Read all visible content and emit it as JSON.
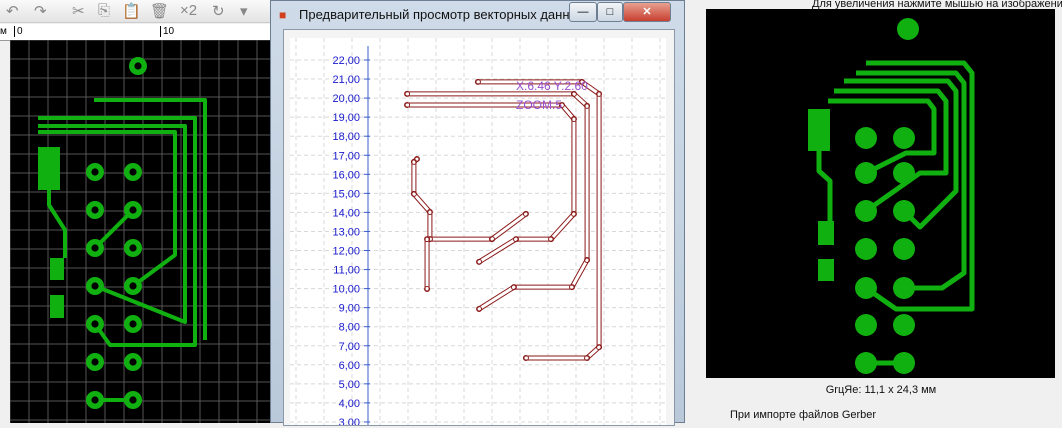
{
  "toolbar": {
    "buttons": [
      {
        "icon": "undo-icon",
        "label": "↶"
      },
      {
        "icon": "redo-icon",
        "label": "↷"
      },
      {
        "icon": "cut-icon",
        "label": "✂"
      },
      {
        "icon": "copy-icon",
        "label": "⎘"
      },
      {
        "icon": "paste-icon",
        "label": "📋"
      },
      {
        "icon": "delete-icon",
        "label": "🗑"
      },
      {
        "icon": "multiply-icon",
        "label": "×2"
      },
      {
        "icon": "rotate-icon",
        "label": "↻"
      },
      {
        "icon": "dropdown-icon",
        "label": "▾"
      }
    ]
  },
  "ruler": {
    "unit": "м",
    "ticks": [
      "0",
      "10"
    ]
  },
  "dialog": {
    "title": "Предварительный просмотр векторных данных",
    "minimize": "—",
    "maximize": "□",
    "close": "✕",
    "coords": "X:6.46 Y:2.60",
    "zoom": "ZOOM:5"
  },
  "chart_data": {
    "type": "line",
    "yticks": [
      "22,00",
      "21,00",
      "20,00",
      "19,00",
      "18,00",
      "17,00",
      "16,00",
      "15,00",
      "14,00",
      "13,00",
      "12,00",
      "11,00",
      "10,00",
      "9,00",
      "8,00",
      "7,00",
      "6,00",
      "5,00",
      "4,00",
      "3,00"
    ],
    "ylim": [
      3,
      22
    ],
    "grid": true,
    "colors": {
      "trace": "#8b1a1a",
      "axis": "#3a5fcd",
      "label": "#1a1acd",
      "annotation": "#9a4fd0"
    },
    "traces": [
      [
        [
          5.77,
          20.85
        ],
        [
          11.23,
          20.85
        ],
        [
          12.13,
          20.22
        ],
        [
          12.13,
          6.93
        ],
        [
          11.5,
          6.36
        ],
        [
          8.29,
          6.36
        ]
      ],
      [
        [
          2.05,
          20.22
        ],
        [
          10.81,
          20.22
        ],
        [
          11.5,
          19.59
        ],
        [
          11.5,
          11.5
        ],
        [
          10.71,
          10.08
        ],
        [
          7.66,
          10.08
        ],
        [
          5.83,
          8.93
        ]
      ],
      [
        [
          2.05,
          19.64
        ],
        [
          10.18,
          19.64
        ],
        [
          10.81,
          18.9
        ],
        [
          10.81,
          13.92
        ],
        [
          9.61,
          12.6
        ],
        [
          7.77,
          12.6
        ],
        [
          5.83,
          11.4
        ]
      ],
      [
        [
          2.57,
          16.8
        ],
        [
          2.41,
          16.65
        ],
        [
          2.41,
          14.97
        ],
        [
          3.25,
          14.02
        ],
        [
          3.25,
          12.6
        ],
        [
          6.51,
          12.6
        ],
        [
          8.29,
          13.92
        ]
      ],
      [
        [
          3.1,
          12.6
        ],
        [
          3.1,
          9.98
        ]
      ]
    ]
  },
  "right": {
    "hint": "Для увеличения нажмите мышью на изображение",
    "size": "GrцЯe: 11,1 x 24,3 мм",
    "gerber": "При импорте файлов Gerber"
  },
  "colors": {
    "pcb_copper": "#10b010",
    "pcb_bg": "#000000"
  }
}
